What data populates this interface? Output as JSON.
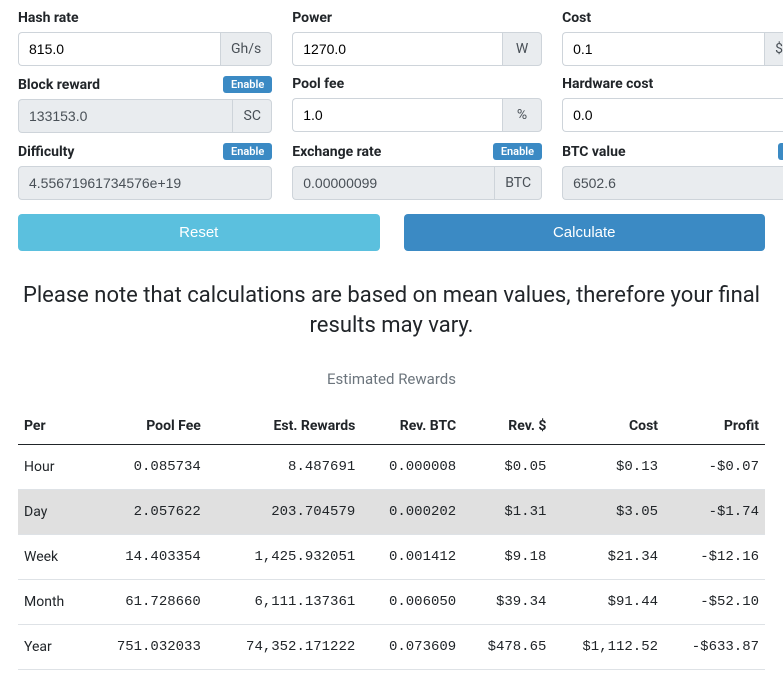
{
  "fields": {
    "hash_rate": {
      "label": "Hash rate",
      "value": "815.0",
      "unit": "Gh/s",
      "enable": false,
      "disabled": false
    },
    "power": {
      "label": "Power",
      "value": "1270.0",
      "unit": "W",
      "enable": false,
      "disabled": false
    },
    "cost": {
      "label": "Cost",
      "value": "0.1",
      "unit": "$/kWh",
      "enable": false,
      "disabled": false
    },
    "block_reward": {
      "label": "Block reward",
      "value": "133153.0",
      "unit": "SC",
      "enable": true,
      "disabled": true
    },
    "pool_fee": {
      "label": "Pool fee",
      "value": "1.0",
      "unit": "%",
      "enable": false,
      "disabled": false
    },
    "hardware_cost": {
      "label": "Hardware cost",
      "value": "0.0",
      "unit": "$",
      "enable": false,
      "disabled": false
    },
    "difficulty": {
      "label": "Difficulty",
      "value": "4.55671961734576e+19",
      "unit": "",
      "enable": true,
      "disabled": true
    },
    "exchange_rate": {
      "label": "Exchange rate",
      "value": "0.00000099",
      "unit": "BTC",
      "enable": true,
      "disabled": true
    },
    "btc_value": {
      "label": "BTC value",
      "value": "6502.6",
      "unit": "$",
      "enable": true,
      "disabled": true
    }
  },
  "enable_label": "Enable",
  "buttons": {
    "reset": "Reset",
    "calculate": "Calculate"
  },
  "note": "Please note that calculations are based on mean values, therefore your final results may vary.",
  "table": {
    "caption": "Estimated Rewards",
    "headers": {
      "per": "Per",
      "pool_fee": "Pool Fee",
      "est_rewards": "Est. Rewards",
      "rev_btc": "Rev. BTC",
      "rev_usd": "Rev. $",
      "cost": "Cost",
      "profit": "Profit"
    },
    "rows": [
      {
        "per": "Hour",
        "pool_fee": "0.085734",
        "est_rewards": "8.487691",
        "rev_btc": "0.000008",
        "rev_usd": "$0.05",
        "cost": "$0.13",
        "profit": "-$0.07",
        "hl": false
      },
      {
        "per": "Day",
        "pool_fee": "2.057622",
        "est_rewards": "203.704579",
        "rev_btc": "0.000202",
        "rev_usd": "$1.31",
        "cost": "$3.05",
        "profit": "-$1.74",
        "hl": true
      },
      {
        "per": "Week",
        "pool_fee": "14.403354",
        "est_rewards": "1,425.932051",
        "rev_btc": "0.001412",
        "rev_usd": "$9.18",
        "cost": "$21.34",
        "profit": "-$12.16",
        "hl": false
      },
      {
        "per": "Month",
        "pool_fee": "61.728660",
        "est_rewards": "6,111.137361",
        "rev_btc": "0.006050",
        "rev_usd": "$39.34",
        "cost": "$91.44",
        "profit": "-$52.10",
        "hl": false
      },
      {
        "per": "Year",
        "pool_fee": "751.032033",
        "est_rewards": "74,352.171222",
        "rev_btc": "0.073609",
        "rev_usd": "$478.65",
        "cost": "$1,112.52",
        "profit": "-$633.87",
        "hl": false
      }
    ]
  }
}
